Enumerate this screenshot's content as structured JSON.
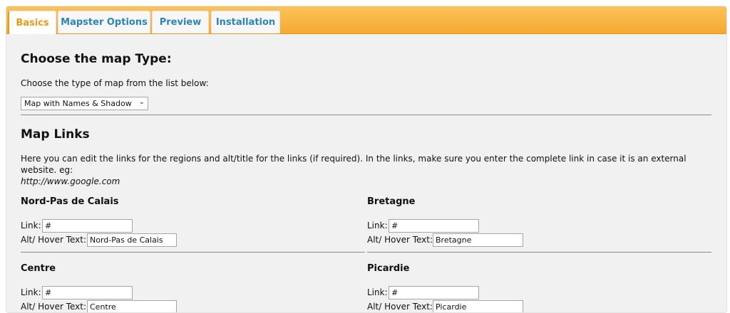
{
  "tabs": [
    {
      "label": "Basics"
    },
    {
      "label": "Mapster Options"
    },
    {
      "label": "Preview"
    },
    {
      "label": "Installation"
    }
  ],
  "map_type": {
    "heading": "Choose the map Type:",
    "instruction": "Choose the type of map from the list below:",
    "selected": "Map with Names & Shadow"
  },
  "map_links": {
    "heading": "Map Links",
    "description": "Here you can edit the links for the regions and alt/title for the links (if required). In the links, make sure you enter the complete link in case it is an external website. eg:",
    "example": "http://www.google.com"
  },
  "regions": [
    {
      "name": "Nord-Pas de Calais",
      "link_label": "Link:",
      "link": "#",
      "alt_label": "Alt/ Hover Text:",
      "alt": "Nord-Pas de Calais"
    },
    {
      "name": "Bretagne",
      "link_label": "Link:",
      "link": "#",
      "alt_label": "Alt/ Hover Text:",
      "alt": "Bretagne"
    },
    {
      "name": "Centre",
      "link_label": "Link:",
      "link": "#",
      "alt_label": "Alt/ Hover Text:",
      "alt": "Centre"
    },
    {
      "name": "Picardie",
      "link_label": "Link:",
      "link": "#",
      "alt_label": "Alt/ Hover Text:",
      "alt": "Picardie"
    }
  ]
}
